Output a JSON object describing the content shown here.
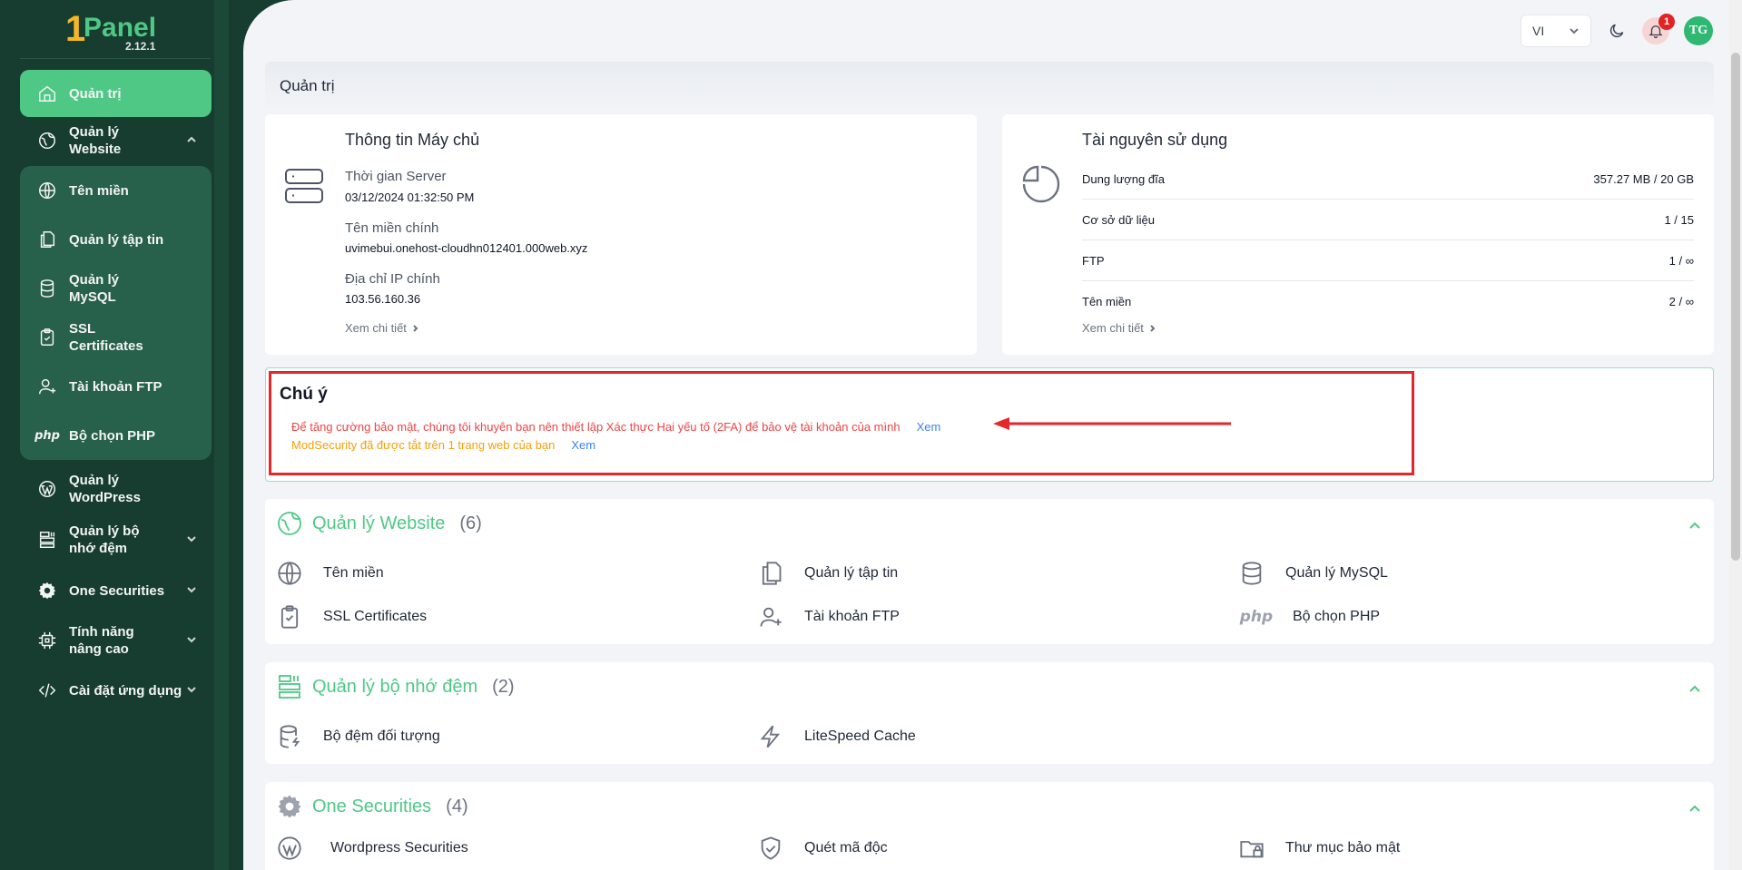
{
  "brand": {
    "logo_one": "1",
    "logo_panel": "Panel",
    "version": "2.12.1"
  },
  "sidebar": {
    "items": [
      {
        "label": "Quản trị",
        "icon": "home-icon",
        "active": true
      },
      {
        "label": "Quản lý Website",
        "icon": "globe-leaf-icon",
        "expanded": true
      },
      {
        "label": "Quản lý WordPress",
        "icon": "wordpress-icon"
      },
      {
        "label": "Quản lý bộ nhớ đệm",
        "icon": "cache-icon"
      },
      {
        "label": "One Securities",
        "icon": "gear-icon"
      },
      {
        "label": "Tính năng nâng cao",
        "icon": "chip-icon"
      },
      {
        "label": "Cài đặt ứng dụng",
        "icon": "code-icon"
      }
    ],
    "submenu": [
      {
        "label": "Tên miền",
        "icon": "globe-icon"
      },
      {
        "label": "Quản lý tập tin",
        "icon": "files-icon"
      },
      {
        "label": "Quản lý MySQL",
        "icon": "database-icon"
      },
      {
        "label": "SSL Certificates",
        "icon": "clipboard-check-icon"
      },
      {
        "label": "Tài khoản FTP",
        "icon": "user-plus-icon"
      },
      {
        "label": "Bộ chọn PHP",
        "icon": "php-icon",
        "icon_text": "php"
      }
    ]
  },
  "topbar": {
    "language": "VI",
    "notifications": "1",
    "avatar": "TG"
  },
  "page": {
    "breadcrumb": "Quản trị"
  },
  "server_info": {
    "title": "Thông tin Máy chủ",
    "time_label": "Thời gian Server",
    "time_value": "03/12/2024 01:32:50 PM",
    "domain_label": "Tên miền chính",
    "domain_value": "uvimebui.onehost-cloudhn012401.000web.xyz",
    "ip_label": "Địa chỉ IP chính",
    "ip_value": "103.56.160.36",
    "detail_link": "Xem chi tiết"
  },
  "resources": {
    "title": "Tài nguyên sử dụng",
    "rows": [
      {
        "label": "Dung lượng đĩa",
        "value": "357.27 MB / 20 GB"
      },
      {
        "label": "Cơ sở dữ liệu",
        "value": "1 / 15"
      },
      {
        "label": "FTP",
        "value": "1 / ∞"
      },
      {
        "label": "Tên miền",
        "value": "2 / ∞"
      }
    ],
    "detail_link": "Xem chi tiết"
  },
  "notice": {
    "title": "Chú ý",
    "line1": "Để tăng cường bảo mật, chúng tôi khuyên bạn nên thiết lập Xác thực Hai yếu tố (2FA) để bảo vệ tài khoản của mình",
    "line1_link": "Xem",
    "line2": "ModSecurity đã được tắt trên 1 trang web của bạn",
    "line2_link": "Xem"
  },
  "sections": {
    "website": {
      "title": "Quản lý Website",
      "count": "(6)",
      "items": [
        {
          "label": "Tên miền",
          "icon": "globe-icon"
        },
        {
          "label": "Quản lý tập tin",
          "icon": "files-icon"
        },
        {
          "label": "Quản lý MySQL",
          "icon": "database-icon"
        },
        {
          "label": "SSL Certificates",
          "icon": "clipboard-check-icon"
        },
        {
          "label": "Tài khoản FTP",
          "icon": "user-plus-icon"
        },
        {
          "label": "Bộ chọn PHP",
          "icon": "php-icon",
          "icon_text": "php"
        }
      ]
    },
    "cache": {
      "title": "Quản lý bộ nhớ đệm",
      "count": "(2)",
      "items": [
        {
          "label": "Bộ đệm đối tượng",
          "icon": "database-bolt-icon"
        },
        {
          "label": "LiteSpeed Cache",
          "icon": "lightning-icon"
        }
      ]
    },
    "security": {
      "title": "One Securities",
      "count": "(4)",
      "items": [
        {
          "label": "Wordpress Securities",
          "icon": "wordpress-icon"
        },
        {
          "label": "Quét mã độc",
          "icon": "shield-check-icon"
        },
        {
          "label": "Thư mục bảo mật",
          "icon": "folder-lock-icon"
        }
      ]
    }
  },
  "colors": {
    "sidebar_bg": "#163d2f",
    "accent": "#4fc885",
    "notice_red": "#ef4444",
    "notice_orange": "#f59e0b",
    "link_blue": "#3b82f6",
    "highlight_frame": "#e5262a"
  }
}
